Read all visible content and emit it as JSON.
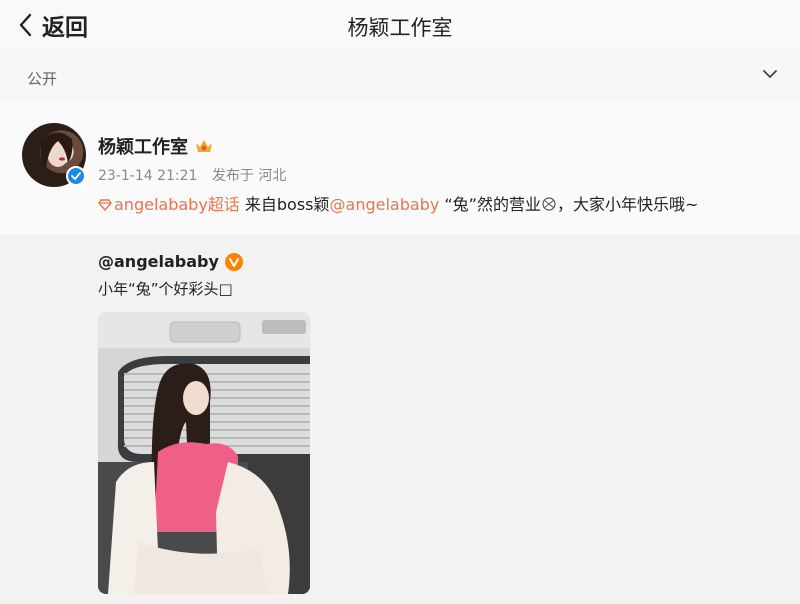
{
  "nav": {
    "back_label": "返回",
    "title": "杨颖工作室"
  },
  "visibility": {
    "label": "公开"
  },
  "post": {
    "author": "杨颖工作室",
    "date": "23-1-14 21:21",
    "published_from": "发布于 河北",
    "topic": "angelababy超话",
    "text_from": " 来自boss颖",
    "mention": "@angelababy",
    "text_body_1": " “兔”然的营业",
    "text_body_2": "，大家小年快乐哦~"
  },
  "repost": {
    "author": "@angelababy",
    "text": "小年“兔”个好彩头□"
  },
  "colors": {
    "link": "#eb7350",
    "verified_blue": "#1e88e5",
    "verified_orange": "#ff8200"
  }
}
